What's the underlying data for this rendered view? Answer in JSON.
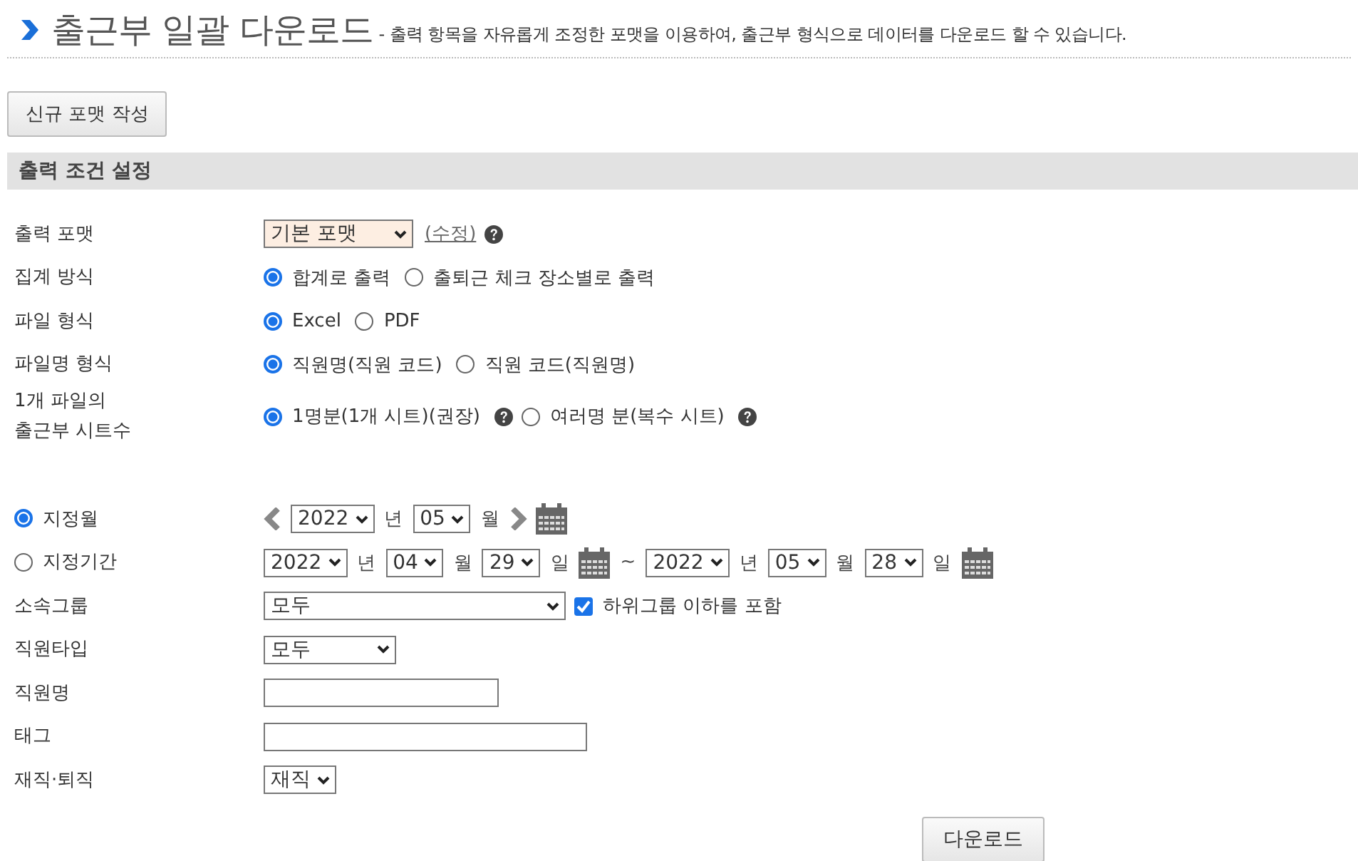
{
  "header": {
    "title": "출근부 일괄 다운로드",
    "description": "- 출력 항목을 자유롭게 조정한 포맷을 이용하여, 출근부 형식으로 데이터를 다운로드 할 수 있습니다."
  },
  "new_format_button": "신규 포맷 작성",
  "section_title": "출력 조건 설정",
  "options": [
    {
      "label": "출력 포맷",
      "controls": [
        {
          "kind": "select",
          "value": "기본 포맷"
        },
        {
          "kind": "link",
          "text": "(수정)"
        },
        {
          "kind": "help"
        }
      ]
    },
    {
      "label": "집계 방식",
      "controls": [
        {
          "kind": "radio",
          "label": "합계로 출력",
          "selected": true
        },
        {
          "kind": "radio",
          "label": "출퇴근 체크 장소별로 출력",
          "selected": false
        }
      ]
    },
    {
      "label": "파일 형식",
      "controls": [
        {
          "kind": "radio",
          "label": "Excel",
          "selected": true
        },
        {
          "kind": "radio",
          "label": "PDF",
          "selected": false
        }
      ]
    },
    {
      "label": "파일명 형식",
      "controls": [
        {
          "kind": "radio",
          "label": "직원명(직원 코드)",
          "selected": true
        },
        {
          "kind": "radio",
          "label": "직원 코드(직원명)",
          "selected": false
        }
      ]
    },
    {
      "label": "1개 파일의\n출근부 시트수",
      "controls": [
        {
          "kind": "radio",
          "label": "1명분(1개 시트)(권장)",
          "selected": true
        },
        {
          "kind": "help"
        },
        {
          "kind": "radio",
          "label": "여러명 분(복수 시트)",
          "selected": false
        },
        {
          "kind": "help"
        }
      ]
    }
  ],
  "filters": [
    {
      "choice": {
        "label": "지정월",
        "selected": true
      },
      "controls": [
        {
          "kind": "prev"
        },
        {
          "kind": "select",
          "value": "2022"
        },
        {
          "kind": "text",
          "text": "년"
        },
        {
          "kind": "select",
          "value": "05"
        },
        {
          "kind": "text",
          "text": "월"
        },
        {
          "kind": "next"
        },
        {
          "kind": "calendar"
        }
      ]
    },
    {
      "choice": {
        "label": "지정기간",
        "selected": false
      },
      "controls": [
        {
          "kind": "select",
          "value": "2022"
        },
        {
          "kind": "text",
          "text": "년"
        },
        {
          "kind": "select",
          "value": "04"
        },
        {
          "kind": "text",
          "text": "월"
        },
        {
          "kind": "select",
          "value": "29"
        },
        {
          "kind": "text",
          "text": "일"
        },
        {
          "kind": "calendar"
        },
        {
          "kind": "text",
          "text": "~"
        },
        {
          "kind": "select",
          "value": "2022"
        },
        {
          "kind": "text",
          "text": "년"
        },
        {
          "kind": "select",
          "value": "05"
        },
        {
          "kind": "text",
          "text": "월"
        },
        {
          "kind": "select",
          "value": "28"
        },
        {
          "kind": "text",
          "text": "일"
        },
        {
          "kind": "calendar"
        }
      ]
    },
    {
      "label": "소속그룹",
      "controls": [
        {
          "kind": "select",
          "value": "모두"
        },
        {
          "kind": "checkbox",
          "label": "하위그룹 이하를 포함",
          "checked": true
        }
      ]
    },
    {
      "label": "직원타입",
      "controls": [
        {
          "kind": "select",
          "value": "모두"
        }
      ]
    },
    {
      "label": "직원명",
      "controls": [
        {
          "kind": "input"
        }
      ]
    },
    {
      "label": "태그",
      "controls": [
        {
          "kind": "input"
        }
      ]
    },
    {
      "label": "재직·퇴직",
      "controls": [
        {
          "kind": "select",
          "value": "재직"
        }
      ]
    }
  ],
  "download_button": "다운로드"
}
